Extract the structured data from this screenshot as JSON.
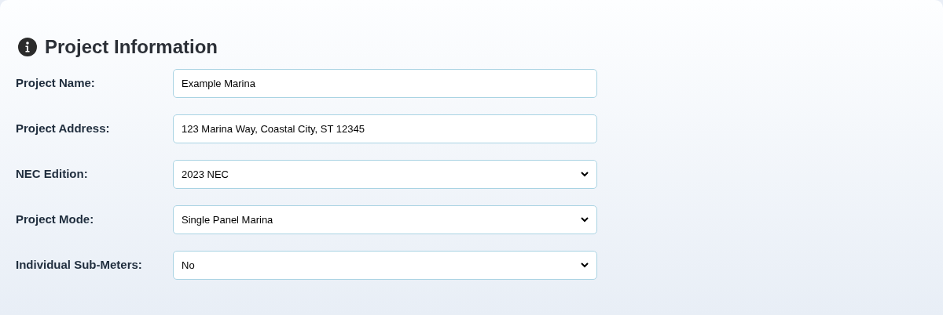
{
  "section": {
    "title": "Project Information"
  },
  "fields": [
    {
      "label": "Project Name:",
      "kind": "text",
      "value": "Example Marina"
    },
    {
      "label": "Project Address:",
      "kind": "text",
      "value": "123 Marina Way, Coastal City, ST 12345"
    },
    {
      "label": "NEC Edition:",
      "kind": "select",
      "value": "2023 NEC"
    },
    {
      "label": "Project Mode:",
      "kind": "select",
      "value": "Single Panel Marina"
    },
    {
      "label": "Individual Sub-Meters:",
      "kind": "select",
      "value": "No"
    }
  ]
}
